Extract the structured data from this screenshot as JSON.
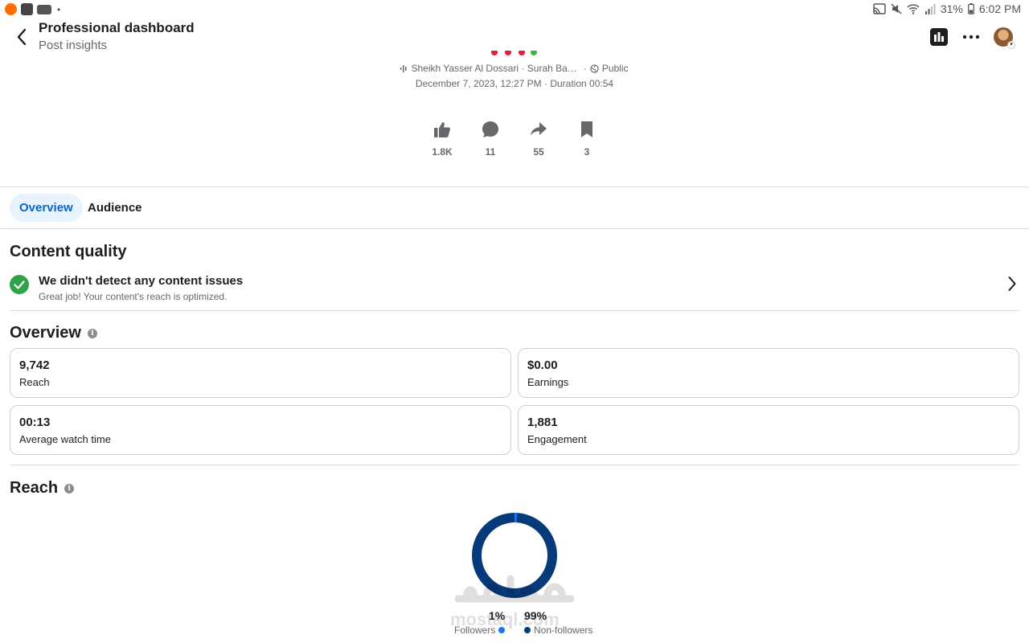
{
  "status_bar": {
    "battery": "31%",
    "time": "6:02 PM",
    "dot": "•"
  },
  "header": {
    "title": "Professional dashboard",
    "subtitle": "Post insights"
  },
  "post": {
    "audio": "Sheikh Yasser Al Dossari · Surah Ba…",
    "separator": "·",
    "privacy": "Public",
    "date_line": "December 7, 2023, 12:27 PM · Duration 00:54",
    "stats": [
      {
        "icon": "like-icon",
        "value": "1.8K"
      },
      {
        "icon": "comment-icon",
        "value": "11"
      },
      {
        "icon": "share-icon",
        "value": "55"
      },
      {
        "icon": "bookmark-icon",
        "value": "3"
      }
    ]
  },
  "tabs": [
    {
      "label": "Overview",
      "active": true
    },
    {
      "label": "Audience",
      "active": false
    }
  ],
  "content_quality": {
    "title": "Content quality",
    "status_title": "We didn't detect any content issues",
    "status_sub": "Great job! Your content's reach is optimized."
  },
  "overview": {
    "title": "Overview",
    "info": "i",
    "cards": [
      {
        "value": "9,742",
        "label": "Reach"
      },
      {
        "value": "$0.00",
        "label": "Earnings"
      },
      {
        "value": "00:13",
        "label": "Average watch time"
      },
      {
        "value": "1,881",
        "label": "Engagement"
      }
    ]
  },
  "reach": {
    "title": "Reach",
    "info": "i",
    "followers_pct": "1%",
    "followers_label": "Followers",
    "non_followers_pct": "99%",
    "non_followers_label": "Non-followers",
    "followers_color": "#1877f2",
    "non_followers_color": "#063a7a",
    "followers_fraction": 0.01
  },
  "watermark": {
    "text": "mostaql.com"
  },
  "colors": {
    "accent": "#0a66c2",
    "check": "#31a24c"
  }
}
